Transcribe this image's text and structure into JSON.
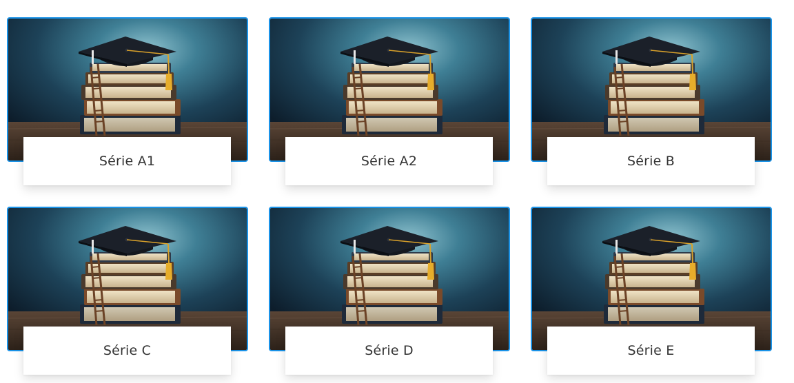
{
  "series_cards": [
    {
      "label": "Série A1",
      "image": "graduation-cap-on-books-image"
    },
    {
      "label": "Série A2",
      "image": "graduation-cap-on-books-image"
    },
    {
      "label": "Série B",
      "image": "graduation-cap-on-books-image"
    },
    {
      "label": "Série C",
      "image": "graduation-cap-on-books-image"
    },
    {
      "label": "Série D",
      "image": "graduation-cap-on-books-image"
    },
    {
      "label": "Série E",
      "image": "graduation-cap-on-books-image"
    }
  ],
  "colors": {
    "card_border": "#1a93e8",
    "label_text": "#333333",
    "label_background": "#ffffff"
  }
}
